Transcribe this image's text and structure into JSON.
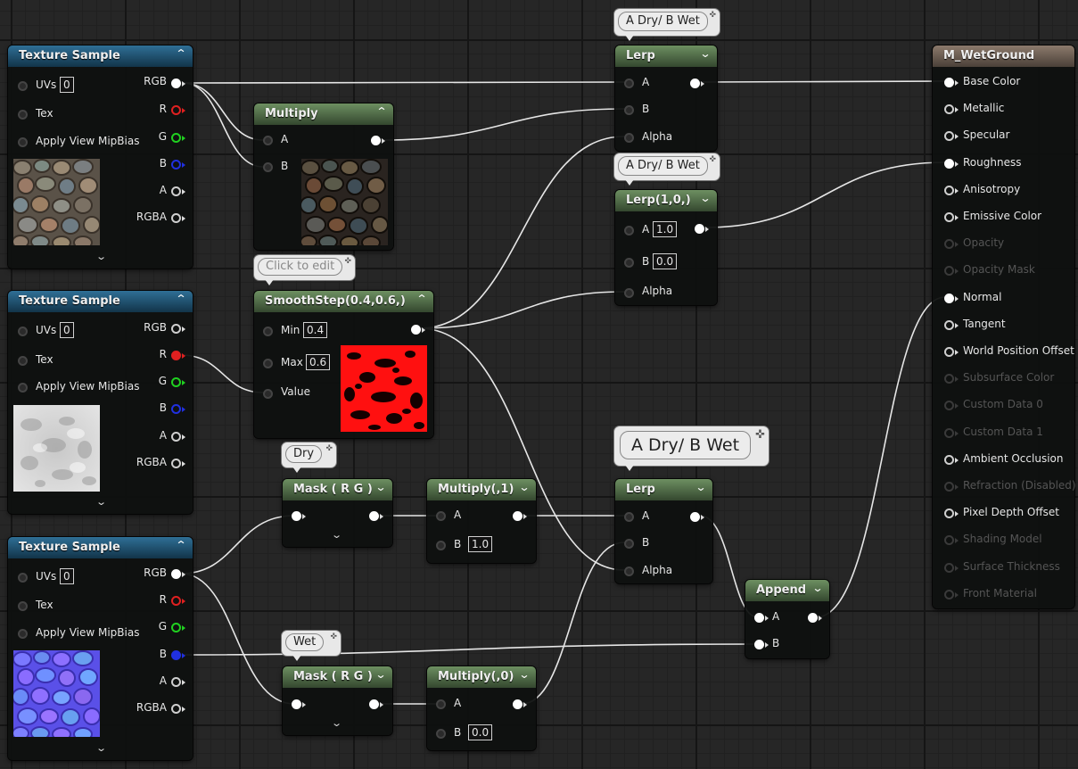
{
  "nodes": {
    "tex1": {
      "title": "Texture Sample",
      "uvs_label": "UVs",
      "uvs_value": "0",
      "tex_label": "Tex",
      "mip_label": "Apply View MipBias",
      "outputs": [
        "RGB",
        "R",
        "G",
        "B",
        "A",
        "RGBA"
      ],
      "thumbnail": "cobblestone-color"
    },
    "tex2": {
      "title": "Texture Sample",
      "uvs_label": "UVs",
      "uvs_value": "0",
      "tex_label": "Tex",
      "mip_label": "Apply View MipBias",
      "outputs": [
        "RGB",
        "R",
        "G",
        "B",
        "A",
        "RGBA"
      ],
      "thumbnail": "grayscale-noise"
    },
    "tex3": {
      "title": "Texture Sample",
      "uvs_label": "UVs",
      "uvs_value": "0",
      "tex_label": "Tex",
      "mip_label": "Apply View MipBias",
      "outputs": [
        "RGB",
        "R",
        "G",
        "B",
        "A",
        "RGBA"
      ],
      "thumbnail": "cobblestone-normal"
    },
    "multiply": {
      "title": "Multiply",
      "in_a": "A",
      "in_b": "B"
    },
    "smoothstep": {
      "title": "SmoothStep(0.4,0.6,)",
      "min_label": "Min",
      "min_value": "0.4",
      "max_label": "Max",
      "max_value": "0.6",
      "value_label": "Value"
    },
    "mask_dry": {
      "title": "Mask ( R G )"
    },
    "mask_wet": {
      "title": "Mask ( R G )"
    },
    "multiply_1": {
      "title": "Multiply(,1)",
      "in_a": "A",
      "in_b": "B",
      "b_value": "1.0"
    },
    "multiply_0": {
      "title": "Multiply(,0)",
      "in_a": "A",
      "in_b": "B",
      "b_value": "0.0"
    },
    "lerp_top": {
      "title": "Lerp",
      "in_a": "A",
      "in_b": "B",
      "in_alpha": "Alpha"
    },
    "lerp_rough": {
      "title": "Lerp(1,0,)",
      "in_a": "A",
      "a_value": "1.0",
      "in_b": "B",
      "b_value": "0.0",
      "in_alpha": "Alpha"
    },
    "lerp_normal": {
      "title": "Lerp",
      "in_a": "A",
      "in_b": "B",
      "in_alpha": "Alpha"
    },
    "append": {
      "title": "Append",
      "in_a": "A",
      "in_b": "B"
    },
    "result": {
      "title": "M_WetGround",
      "inputs": [
        {
          "label": "Base Color",
          "enabled": true,
          "connected": true
        },
        {
          "label": "Metallic",
          "enabled": true,
          "connected": false
        },
        {
          "label": "Specular",
          "enabled": true,
          "connected": false
        },
        {
          "label": "Roughness",
          "enabled": true,
          "connected": true
        },
        {
          "label": "Anisotropy",
          "enabled": true,
          "connected": false
        },
        {
          "label": "Emissive Color",
          "enabled": true,
          "connected": false
        },
        {
          "label": "Opacity",
          "enabled": false,
          "connected": false
        },
        {
          "label": "Opacity Mask",
          "enabled": false,
          "connected": false
        },
        {
          "label": "Normal",
          "enabled": true,
          "connected": true
        },
        {
          "label": "Tangent",
          "enabled": true,
          "connected": false
        },
        {
          "label": "World Position Offset",
          "enabled": true,
          "connected": false
        },
        {
          "label": "Subsurface Color",
          "enabled": false,
          "connected": false
        },
        {
          "label": "Custom Data 0",
          "enabled": false,
          "connected": false
        },
        {
          "label": "Custom Data 1",
          "enabled": false,
          "connected": false
        },
        {
          "label": "Ambient Occlusion",
          "enabled": true,
          "connected": false
        },
        {
          "label": "Refraction (Disabled)",
          "enabled": false,
          "connected": false
        },
        {
          "label": "Pixel Depth Offset",
          "enabled": true,
          "connected": false
        },
        {
          "label": "Shading Model",
          "enabled": false,
          "connected": false
        },
        {
          "label": "Surface Thickness",
          "enabled": false,
          "connected": false
        },
        {
          "label": "Front Material",
          "enabled": false,
          "connected": false
        }
      ]
    }
  },
  "comments": {
    "lerp_top": "A Dry/ B Wet",
    "lerp_rough": "A Dry/ B Wet",
    "smoothstep": "Click to edit",
    "mask_dry": "Dry",
    "mask_wet": "Wet",
    "lerp_normal": "A Dry/ B Wet"
  },
  "colors": {
    "texture_header": "#2f6f96",
    "math_header": "#6d8f61",
    "result_header": "#8c7a6c",
    "pin_red": "#e02020",
    "pin_green": "#20d020",
    "pin_blue": "#2030e0",
    "wire": "#e6e6e6"
  }
}
